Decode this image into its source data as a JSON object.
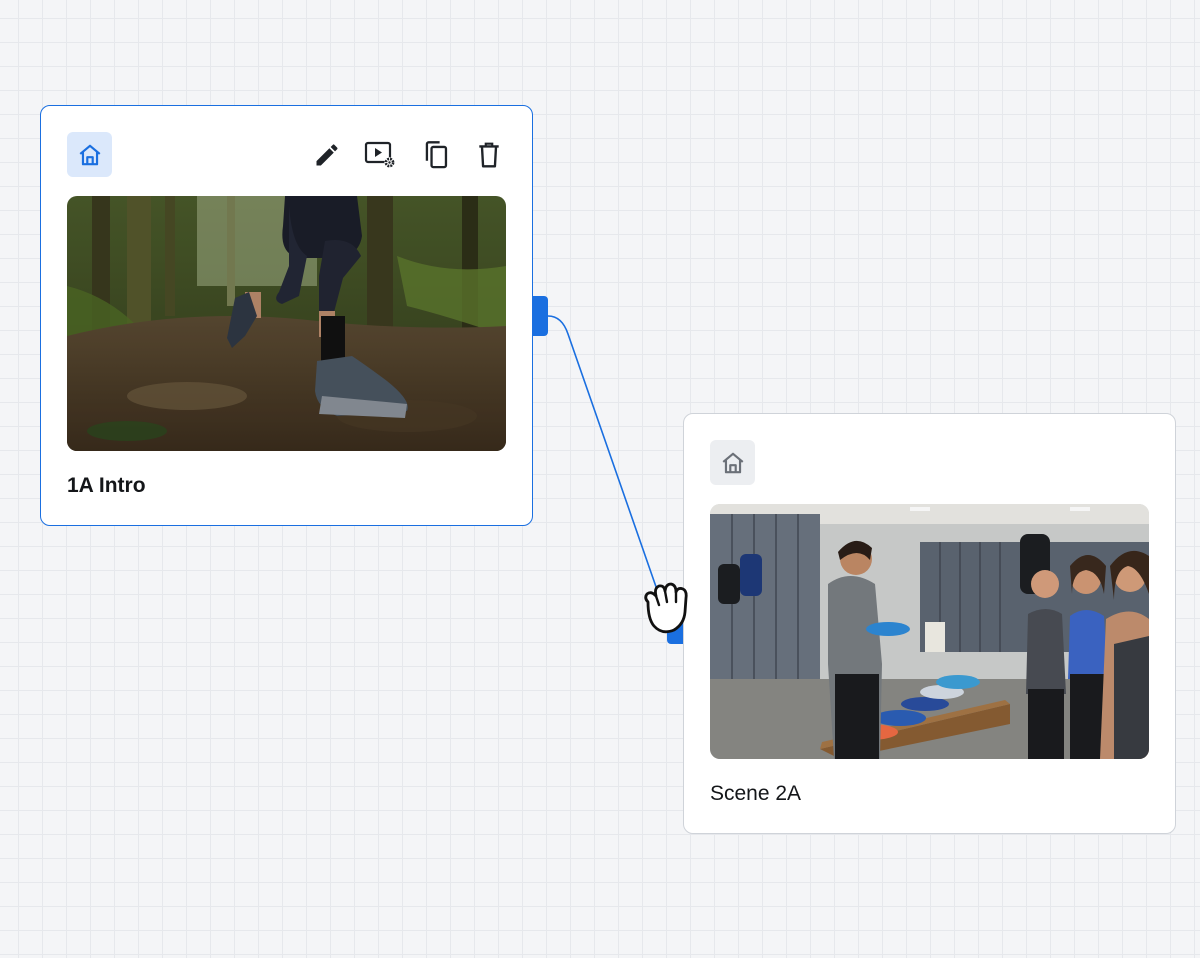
{
  "canvas": {
    "background": "#f4f5f7",
    "grid_color": "#e6e8ec",
    "accent": "#1a6fe0"
  },
  "nodes": [
    {
      "title": "1A Intro",
      "selected": true,
      "home_icon": "home-icon",
      "thumbnail": "trail-runner-forest-image",
      "toolbar": [
        {
          "icon": "pencil-icon",
          "action": "edit"
        },
        {
          "icon": "video-settings-icon",
          "action": "video settings"
        },
        {
          "icon": "copy-icon",
          "action": "duplicate"
        },
        {
          "icon": "trash-icon",
          "action": "delete"
        }
      ]
    },
    {
      "title": "Scene 2A",
      "selected": false,
      "home_icon": "home-icon",
      "thumbnail": "locker-room-shoe-fitting-image"
    }
  ],
  "connection": {
    "from": "1A Intro",
    "to": "Scene 2A",
    "cursor": "grab-hand-icon"
  }
}
